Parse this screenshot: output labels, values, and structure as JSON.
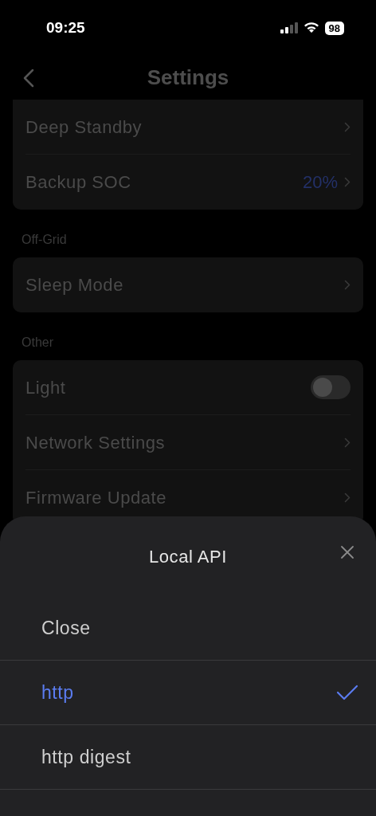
{
  "status_bar": {
    "time": "09:25",
    "battery": "98"
  },
  "header": {
    "title": "Settings"
  },
  "sections": [
    {
      "items": [
        {
          "kind": "nav",
          "label": "Deep Standby"
        },
        {
          "kind": "nav",
          "label": "Backup SOC",
          "value": "20%"
        }
      ]
    },
    {
      "title": "Off-Grid",
      "items": [
        {
          "kind": "nav",
          "label": "Sleep Mode"
        }
      ]
    },
    {
      "title": "Other",
      "items": [
        {
          "kind": "toggle",
          "label": "Light",
          "on": false
        },
        {
          "kind": "nav",
          "label": "Network Settings"
        },
        {
          "kind": "nav",
          "label": "Firmware Update"
        }
      ]
    }
  ],
  "sheet": {
    "title": "Local API",
    "options": [
      {
        "label": "Close",
        "selected": false
      },
      {
        "label": "http",
        "selected": true
      },
      {
        "label": "http digest",
        "selected": false
      }
    ]
  }
}
